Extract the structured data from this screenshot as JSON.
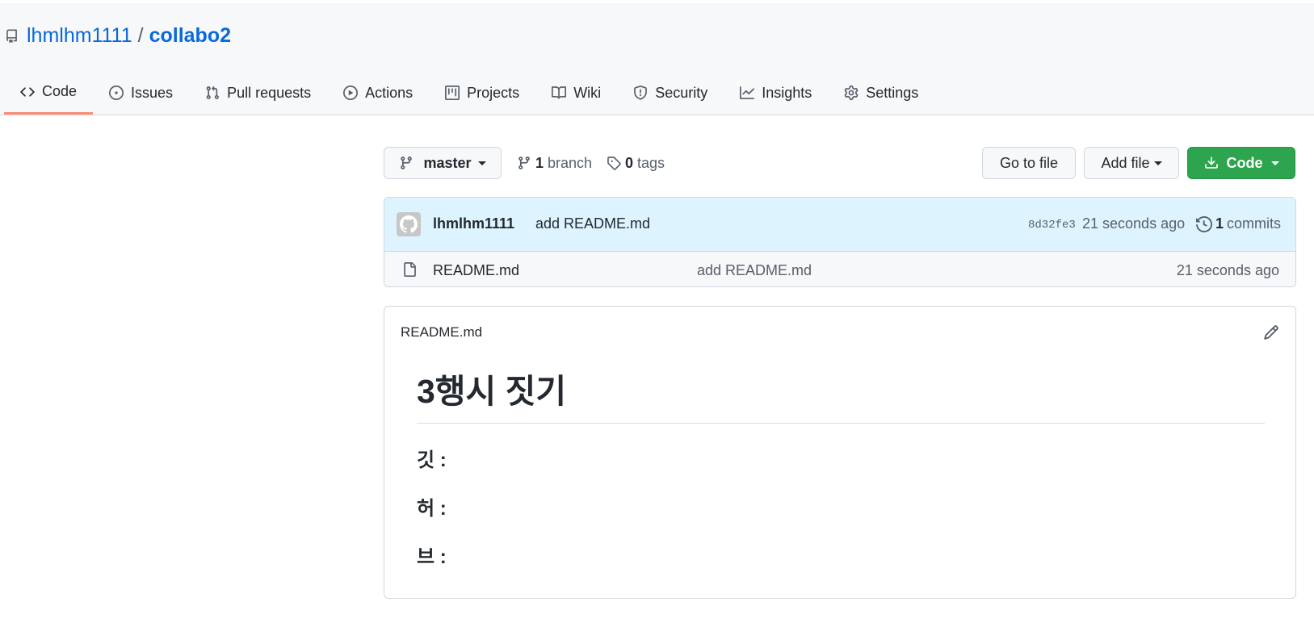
{
  "repo": {
    "owner": "lhmlhm1111",
    "separator": "/",
    "name": "collabo2"
  },
  "tabs": [
    {
      "label": "Code",
      "icon": "code-icon",
      "active": true
    },
    {
      "label": "Issues",
      "icon": "issue-icon"
    },
    {
      "label": "Pull requests",
      "icon": "pull-request-icon"
    },
    {
      "label": "Actions",
      "icon": "play-icon"
    },
    {
      "label": "Projects",
      "icon": "project-icon"
    },
    {
      "label": "Wiki",
      "icon": "book-icon"
    },
    {
      "label": "Security",
      "icon": "shield-icon"
    },
    {
      "label": "Insights",
      "icon": "graph-icon"
    },
    {
      "label": "Settings",
      "icon": "gear-icon"
    }
  ],
  "toolbar": {
    "branch": "master",
    "branch_count": "1",
    "branch_word": "branch",
    "tag_count": "0",
    "tag_word": "tags",
    "go_to_file": "Go to file",
    "add_file": "Add file",
    "code": "Code"
  },
  "latest_commit": {
    "author": "lhmlhm1111",
    "message": "add README.md",
    "sha": "8d32fe3",
    "time": "21 seconds ago",
    "commit_count": "1",
    "commit_word": "commits"
  },
  "files": [
    {
      "name": "README.md",
      "message": "add README.md",
      "time": "21 seconds ago"
    }
  ],
  "readme": {
    "filename": "README.md",
    "h1": "3행시 짓기",
    "lines": [
      "깃 :",
      "허 :",
      "브 :"
    ]
  },
  "colors": {
    "link": "#0969da",
    "active_tab": "#fd8c73",
    "green_button": "#2da44e",
    "commit_bar": "#ddf4ff"
  }
}
